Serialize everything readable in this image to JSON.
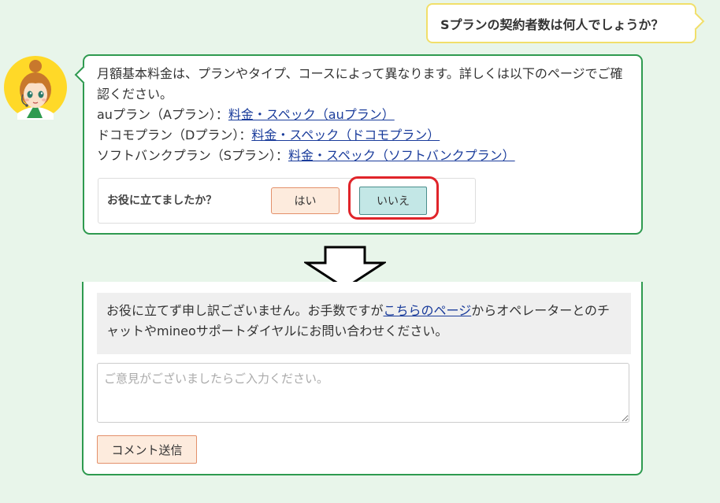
{
  "user_question": "Sプランの契約者数は何人でしょうか？",
  "bot": {
    "intro": "月額基本料金は、プランやタイプ、コースによって異なります。詳しくは以下のページでご確認ください。",
    "plans": [
      {
        "label": "auプラン（Aプラン）：",
        "link": "料金・スペック（auプラン）"
      },
      {
        "label": "ドコモプラン（Dプラン）：",
        "link": "料金・スペック（ドコモプラン）"
      },
      {
        "label": "ソフトバンクプラン（Sプラン）：",
        "link": "料金・スペック（ソフトバンクプラン）"
      }
    ],
    "feedback": {
      "question": "お役に立てましたか？",
      "yes": "はい",
      "no": "いいえ"
    }
  },
  "followup": {
    "apology_before": "お役に立てず申し訳ございません。お手数ですが",
    "apology_link": "こちらのページ",
    "apology_after": "からオペレーターとのチャットやmineoサポートダイヤルにお問い合わせください。",
    "comment_placeholder": "ご意見がございましたらご入力ください。",
    "submit_label": "コメント送信"
  },
  "colors": {
    "background": "#e8f5ea",
    "bot_border": "#2e9a4f",
    "user_border": "#f1df6a",
    "link": "#1a3c9b",
    "highlight": "#e0242a",
    "yes_button": "#fdebdd",
    "no_button": "#c3e7e6"
  }
}
